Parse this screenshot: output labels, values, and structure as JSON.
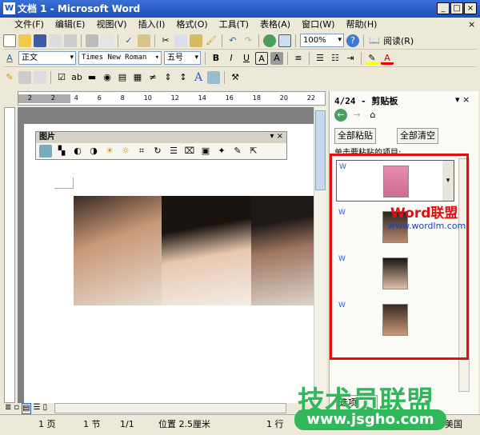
{
  "window": {
    "title": "文档 1 - Microsoft Word",
    "min": "_",
    "max": "□",
    "close": "×"
  },
  "menu": [
    "文件(F)",
    "编辑(E)",
    "视图(V)",
    "插入(I)",
    "格式(O)",
    "工具(T)",
    "表格(A)",
    "窗口(W)",
    "帮助(H)"
  ],
  "menu_close": "×",
  "toolbar": {
    "zoom": "100%",
    "read": "阅读(R)"
  },
  "format": {
    "style": "正文",
    "font": "Times New Roman",
    "size": "五号",
    "bold": "B",
    "italic": "I",
    "underline": "U",
    "char_border": "A",
    "char_shade": "A",
    "font_color": "A"
  },
  "ruler": [
    "2",
    "2",
    "4",
    "6",
    "8",
    "10",
    "12",
    "14",
    "16",
    "18",
    "20",
    "22"
  ],
  "picture_toolbar": {
    "title": "图片"
  },
  "pane": {
    "title": "4/24 - 剪贴板",
    "paste_all": "全部粘贴",
    "clear_all": "全部清空",
    "hint": "单击要粘贴的项目:",
    "options": "选项"
  },
  "watermarks": {
    "word_brand": "Word联盟",
    "word_url": "www.wordlm.com",
    "jsgho_brand": "技术员联盟",
    "jsgho_url": "www.jsgho.com"
  },
  "status": {
    "page": "1 页",
    "section": "1 节",
    "pages": "1/1",
    "position": "位置 2.5厘米",
    "line": "1 行",
    "lang": "美国"
  },
  "colors": {
    "title": "#2a5fc8",
    "highlight": "#e01010",
    "watermark_green": "#2fb85a"
  }
}
